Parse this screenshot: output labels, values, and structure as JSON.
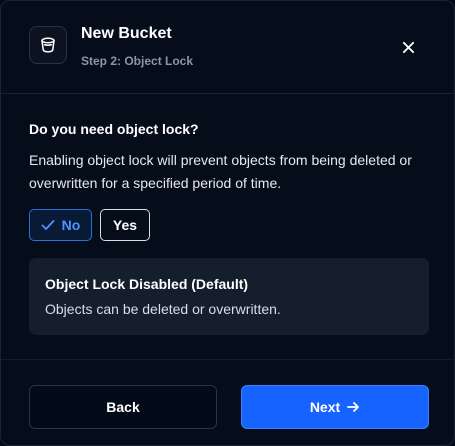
{
  "dialog": {
    "title": "New Bucket",
    "step": "Step 2: Object Lock",
    "icons": {
      "bucket": "bucket-icon",
      "close": "close-icon"
    }
  },
  "object_lock": {
    "question": "Do you need object lock?",
    "description": "Enabling object lock will prevent objects from being deleted or overwritten for a specified period of time.",
    "options": [
      {
        "label": "No",
        "selected": true,
        "icon": "check-icon"
      },
      {
        "label": "Yes",
        "selected": false
      }
    ],
    "info": {
      "title": "Object Lock Disabled (Default)",
      "text": "Objects can be deleted or overwritten."
    }
  },
  "footer": {
    "back_label": "Back",
    "next_label": "Next",
    "next_icon": "arrow-right-icon"
  },
  "colors": {
    "background": "#050c1a",
    "accent": "#1763ff",
    "selected_text": "#4d94ff",
    "info_box": "#151e2d"
  }
}
